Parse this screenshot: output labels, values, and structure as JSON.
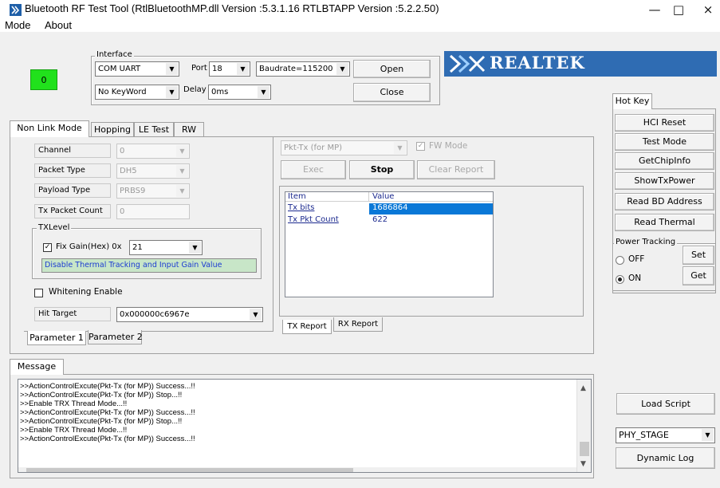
{
  "window": {
    "title": "Bluetooth RF Test Tool (RtlBluetoothMP.dll Version :5.3.1.16  RTLBTAPP Version :5.2.2.50)",
    "minimize": "—",
    "maximize": "□",
    "close": "×"
  },
  "menu": {
    "mode": "Mode",
    "about": "About"
  },
  "status_led": {
    "text": "0",
    "color": "#21e11c"
  },
  "interface": {
    "group_label": "Interface",
    "type": "COM UART",
    "port_label": "Port",
    "port": "18",
    "baudrate": "Baudrate=115200",
    "keyword": "No KeyWord",
    "delay_label": "Delay",
    "delay": "0ms",
    "open": "Open",
    "close": "Close"
  },
  "brand": {
    "name": "REALTEK",
    "color": "#2f6cb3"
  },
  "main_tabs": [
    "Non Link Mode",
    "Hopping",
    "LE Test",
    "RW"
  ],
  "params": {
    "channel_label": "Channel",
    "channel": "0",
    "packet_type_label": "Packet Type",
    "packet_type": "DH5",
    "payload_type_label": "Payload Type",
    "payload_type": "PRBS9",
    "tx_packet_count_label": "Tx Packet Count",
    "tx_packet_count": "0",
    "txlevel_label": "TXLevel",
    "fix_gain_label": "Fix Gain(Hex)  0x",
    "fix_gain": "21",
    "thermal_button": "Disable Thermal Tracking and Input Gain Value",
    "whitening_label": "Whitening Enable",
    "hit_target_label": "Hit Target",
    "hit_target": "0x000000c6967e"
  },
  "param_tabs": [
    "Parameter 1",
    "Parameter 2"
  ],
  "test": {
    "mode": "Pkt-Tx (for MP)",
    "fw_mode": "FW Mode",
    "exec": "Exec",
    "stop": "Stop",
    "clear_report": "Clear Report"
  },
  "report": {
    "columns": [
      "Item",
      "Value"
    ],
    "rows": [
      {
        "item": "Tx bits",
        "value": "1686864",
        "selected": true
      },
      {
        "item": "Tx Pkt Count",
        "value": "622",
        "selected": false
      }
    ],
    "tabs": [
      "TX Report",
      "RX Report"
    ]
  },
  "hotkey": {
    "tab": "Hot Key",
    "buttons": [
      "HCI Reset",
      "Test Mode",
      "GetChipInfo",
      "ShowTxPower",
      "Read BD Address",
      "Read Thermal"
    ]
  },
  "power_tracking": {
    "label": "Power Tracking",
    "off": "OFF",
    "on": "ON",
    "selected": "ON",
    "set": "Set",
    "get": "Get"
  },
  "message": {
    "tab": "Message",
    "lines": [
      ">>ActionControlExcute(Pkt-Tx (for MP)) Success...!!",
      ">>ActionControlExcute(Pkt-Tx (for MP)) Stop...!!",
      ">>Enable TRX Thread Mode...!!",
      ">>ActionControlExcute(Pkt-Tx (for MP)) Success...!!",
      ">>ActionControlExcute(Pkt-Tx (for MP)) Stop...!!",
      ">>Enable TRX Thread Mode...!!",
      ">>ActionControlExcute(Pkt-Tx (for MP)) Success...!!"
    ]
  },
  "side_bottom": {
    "load_script": "Load Script",
    "stage": "PHY_STAGE",
    "dynamic_log": "Dynamic Log"
  }
}
